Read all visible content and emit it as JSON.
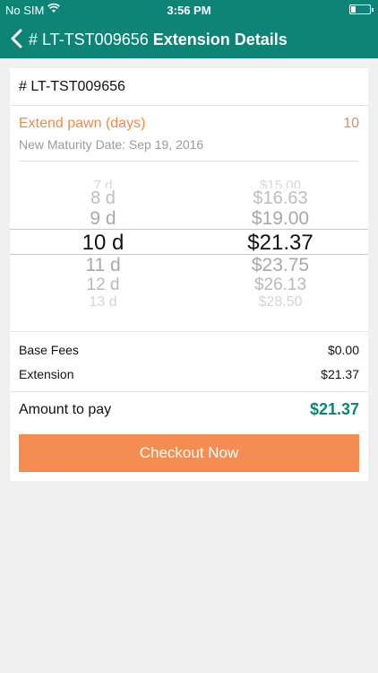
{
  "status_bar": {
    "carrier": "No SIM",
    "time": "3:56 PM"
  },
  "nav": {
    "back_icon": "chevron-left-icon",
    "title_id": "# LT-TST009656",
    "title_text": "Extension Details"
  },
  "loan": {
    "id": "# LT-TST009656"
  },
  "extension": {
    "label": "Extend pawn (days)",
    "value": "10",
    "maturity": "New Maturity Date: Sep 19, 2016"
  },
  "picker": {
    "rows": [
      {
        "days": "7 d",
        "price": "$15.00"
      },
      {
        "days": "8 d",
        "price": "$16.63"
      },
      {
        "days": "9 d",
        "price": "$19.00"
      },
      {
        "days": "10 d",
        "price": "$21.37"
      },
      {
        "days": "11 d",
        "price": "$23.75"
      },
      {
        "days": "12 d",
        "price": "$26.13"
      },
      {
        "days": "13 d",
        "price": "$28.50"
      }
    ]
  },
  "fees": {
    "base_label": "Base Fees",
    "base_value": "$0.00",
    "extension_label": "Extension",
    "extension_value": "$21.37",
    "total_label": "Amount to pay",
    "total_value": "$21.37"
  },
  "checkout": {
    "label": "Checkout Now"
  },
  "colors": {
    "primary": "#0e8477",
    "accent": "#f58d52",
    "label_orange": "#f08a4b"
  }
}
